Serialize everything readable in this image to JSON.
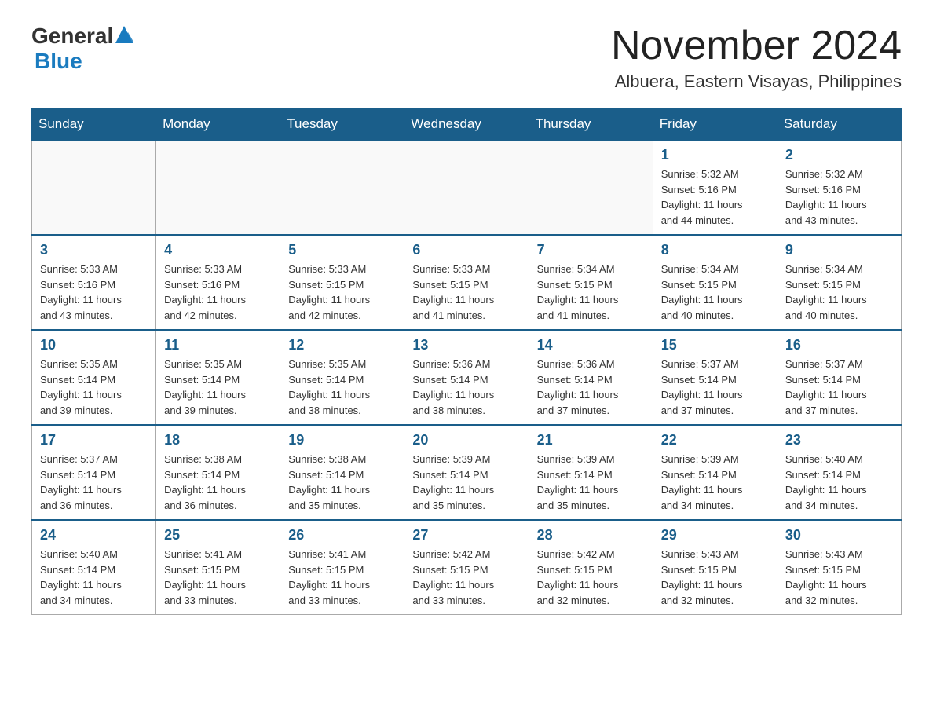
{
  "header": {
    "logo_general": "General",
    "logo_blue": "Blue",
    "month_title": "November 2024",
    "location": "Albuera, Eastern Visayas, Philippines"
  },
  "days_of_week": [
    "Sunday",
    "Monday",
    "Tuesday",
    "Wednesday",
    "Thursday",
    "Friday",
    "Saturday"
  ],
  "weeks": [
    {
      "days": [
        {
          "number": "",
          "info": ""
        },
        {
          "number": "",
          "info": ""
        },
        {
          "number": "",
          "info": ""
        },
        {
          "number": "",
          "info": ""
        },
        {
          "number": "",
          "info": ""
        },
        {
          "number": "1",
          "info": "Sunrise: 5:32 AM\nSunset: 5:16 PM\nDaylight: 11 hours\nand 44 minutes."
        },
        {
          "number": "2",
          "info": "Sunrise: 5:32 AM\nSunset: 5:16 PM\nDaylight: 11 hours\nand 43 minutes."
        }
      ]
    },
    {
      "days": [
        {
          "number": "3",
          "info": "Sunrise: 5:33 AM\nSunset: 5:16 PM\nDaylight: 11 hours\nand 43 minutes."
        },
        {
          "number": "4",
          "info": "Sunrise: 5:33 AM\nSunset: 5:16 PM\nDaylight: 11 hours\nand 42 minutes."
        },
        {
          "number": "5",
          "info": "Sunrise: 5:33 AM\nSunset: 5:15 PM\nDaylight: 11 hours\nand 42 minutes."
        },
        {
          "number": "6",
          "info": "Sunrise: 5:33 AM\nSunset: 5:15 PM\nDaylight: 11 hours\nand 41 minutes."
        },
        {
          "number": "7",
          "info": "Sunrise: 5:34 AM\nSunset: 5:15 PM\nDaylight: 11 hours\nand 41 minutes."
        },
        {
          "number": "8",
          "info": "Sunrise: 5:34 AM\nSunset: 5:15 PM\nDaylight: 11 hours\nand 40 minutes."
        },
        {
          "number": "9",
          "info": "Sunrise: 5:34 AM\nSunset: 5:15 PM\nDaylight: 11 hours\nand 40 minutes."
        }
      ]
    },
    {
      "days": [
        {
          "number": "10",
          "info": "Sunrise: 5:35 AM\nSunset: 5:14 PM\nDaylight: 11 hours\nand 39 minutes."
        },
        {
          "number": "11",
          "info": "Sunrise: 5:35 AM\nSunset: 5:14 PM\nDaylight: 11 hours\nand 39 minutes."
        },
        {
          "number": "12",
          "info": "Sunrise: 5:35 AM\nSunset: 5:14 PM\nDaylight: 11 hours\nand 38 minutes."
        },
        {
          "number": "13",
          "info": "Sunrise: 5:36 AM\nSunset: 5:14 PM\nDaylight: 11 hours\nand 38 minutes."
        },
        {
          "number": "14",
          "info": "Sunrise: 5:36 AM\nSunset: 5:14 PM\nDaylight: 11 hours\nand 37 minutes."
        },
        {
          "number": "15",
          "info": "Sunrise: 5:37 AM\nSunset: 5:14 PM\nDaylight: 11 hours\nand 37 minutes."
        },
        {
          "number": "16",
          "info": "Sunrise: 5:37 AM\nSunset: 5:14 PM\nDaylight: 11 hours\nand 37 minutes."
        }
      ]
    },
    {
      "days": [
        {
          "number": "17",
          "info": "Sunrise: 5:37 AM\nSunset: 5:14 PM\nDaylight: 11 hours\nand 36 minutes."
        },
        {
          "number": "18",
          "info": "Sunrise: 5:38 AM\nSunset: 5:14 PM\nDaylight: 11 hours\nand 36 minutes."
        },
        {
          "number": "19",
          "info": "Sunrise: 5:38 AM\nSunset: 5:14 PM\nDaylight: 11 hours\nand 35 minutes."
        },
        {
          "number": "20",
          "info": "Sunrise: 5:39 AM\nSunset: 5:14 PM\nDaylight: 11 hours\nand 35 minutes."
        },
        {
          "number": "21",
          "info": "Sunrise: 5:39 AM\nSunset: 5:14 PM\nDaylight: 11 hours\nand 35 minutes."
        },
        {
          "number": "22",
          "info": "Sunrise: 5:39 AM\nSunset: 5:14 PM\nDaylight: 11 hours\nand 34 minutes."
        },
        {
          "number": "23",
          "info": "Sunrise: 5:40 AM\nSunset: 5:14 PM\nDaylight: 11 hours\nand 34 minutes."
        }
      ]
    },
    {
      "days": [
        {
          "number": "24",
          "info": "Sunrise: 5:40 AM\nSunset: 5:14 PM\nDaylight: 11 hours\nand 34 minutes."
        },
        {
          "number": "25",
          "info": "Sunrise: 5:41 AM\nSunset: 5:15 PM\nDaylight: 11 hours\nand 33 minutes."
        },
        {
          "number": "26",
          "info": "Sunrise: 5:41 AM\nSunset: 5:15 PM\nDaylight: 11 hours\nand 33 minutes."
        },
        {
          "number": "27",
          "info": "Sunrise: 5:42 AM\nSunset: 5:15 PM\nDaylight: 11 hours\nand 33 minutes."
        },
        {
          "number": "28",
          "info": "Sunrise: 5:42 AM\nSunset: 5:15 PM\nDaylight: 11 hours\nand 32 minutes."
        },
        {
          "number": "29",
          "info": "Sunrise: 5:43 AM\nSunset: 5:15 PM\nDaylight: 11 hours\nand 32 minutes."
        },
        {
          "number": "30",
          "info": "Sunrise: 5:43 AM\nSunset: 5:15 PM\nDaylight: 11 hours\nand 32 minutes."
        }
      ]
    }
  ]
}
